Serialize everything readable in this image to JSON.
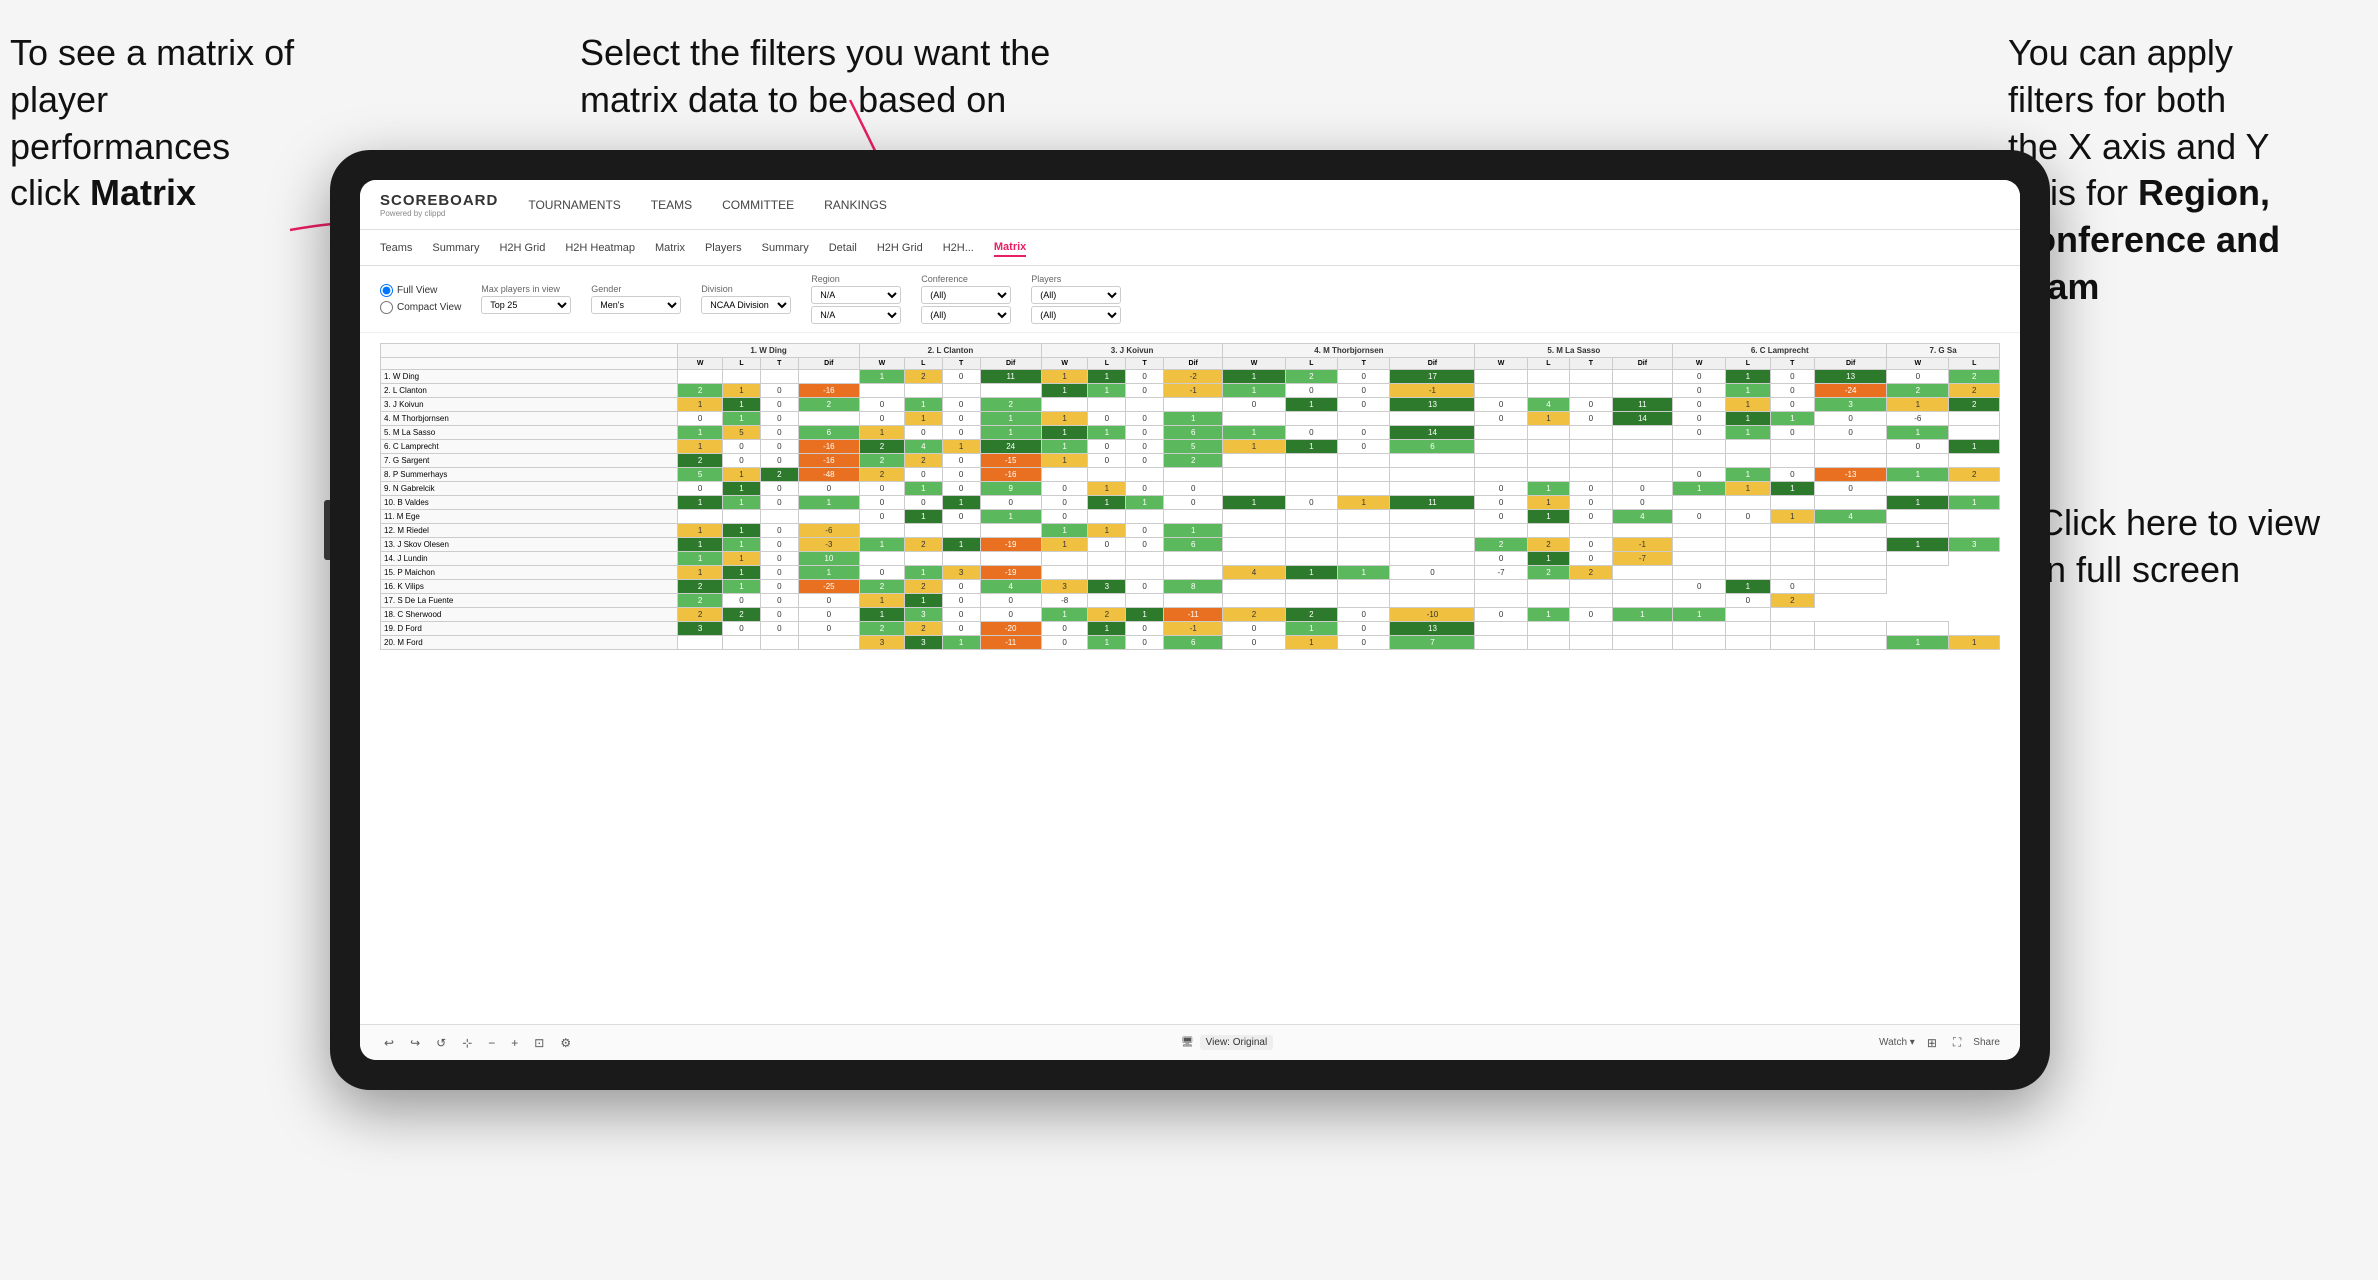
{
  "annotations": {
    "top_left": {
      "line1": "To see a matrix of",
      "line2": "player performances",
      "line3_prefix": "click ",
      "line3_bold": "Matrix"
    },
    "top_center": {
      "line1": "Select the filters you want the",
      "line2": "matrix data to be based on"
    },
    "top_right": {
      "line1": "You  can apply",
      "line2": "filters for both",
      "line3": "the X axis and Y",
      "line4_prefix": "Axis for ",
      "line4_bold": "Region,",
      "line5_bold": "Conference and",
      "line6_bold": "Team"
    },
    "bottom_right": {
      "line1": "Click here to view",
      "line2": "in full screen"
    }
  },
  "nav": {
    "logo": "SCOREBOARD",
    "logo_sub": "Powered by clippd",
    "items": [
      "TOURNAMENTS",
      "TEAMS",
      "COMMITTEE",
      "RANKINGS"
    ]
  },
  "sub_nav": {
    "tabs": [
      "Teams",
      "Summary",
      "H2H Grid",
      "H2H Heatmap",
      "Matrix",
      "Players",
      "Summary",
      "Detail",
      "H2H Grid",
      "H2H...",
      "Matrix"
    ]
  },
  "filters": {
    "view_options": [
      "Full View",
      "Compact View"
    ],
    "max_players_label": "Max players in view",
    "max_players_value": "Top 25",
    "gender_label": "Gender",
    "gender_value": "Men's",
    "division_label": "Division",
    "division_value": "NCAA Division I",
    "region_label": "Region",
    "region_value": "N/A",
    "region_value2": "N/A",
    "conference_label": "Conference",
    "conference_value": "(All)",
    "conference_value2": "(All)",
    "players_label": "Players",
    "players_value": "(All)",
    "players_value2": "(All)"
  },
  "matrix": {
    "col_headers": [
      "1. W Ding",
      "2. L Clanton",
      "3. J Koivun",
      "4. M Thorbjornsen",
      "5. M La Sasso",
      "6. C Lamprecht",
      "7. G Sa"
    ],
    "col_sub": [
      "W",
      "L",
      "T",
      "Dif"
    ],
    "rows": [
      {
        "label": "1. W Ding",
        "cells": [
          "",
          "",
          "",
          "",
          "1",
          "2",
          "0",
          "11",
          "1",
          "1",
          "0",
          "-2",
          "1",
          "2",
          "0",
          "17",
          "",
          "",
          "",
          "",
          "0",
          "1",
          "0",
          "13",
          "0",
          "2"
        ]
      },
      {
        "label": "2. L Clanton",
        "cells": [
          "2",
          "1",
          "0",
          "-16",
          "",
          "",
          "",
          "",
          "1",
          "1",
          "0",
          "-1",
          "1",
          "0",
          "0",
          "-1",
          "",
          "",
          "",
          "",
          "0",
          "1",
          "0",
          "-24",
          "2",
          "2"
        ]
      },
      {
        "label": "3. J Koivun",
        "cells": [
          "1",
          "1",
          "0",
          "2",
          "0",
          "1",
          "0",
          "2",
          "",
          "",
          "",
          "",
          "0",
          "1",
          "0",
          "13",
          "0",
          "4",
          "0",
          "11",
          "0",
          "1",
          "0",
          "3",
          "1",
          "2"
        ]
      },
      {
        "label": "4. M Thorbjornsen",
        "cells": [
          "0",
          "1",
          "0",
          "",
          "0",
          "1",
          "0",
          "1",
          "1",
          "0",
          "0",
          "1",
          "",
          "",
          "",
          "",
          "0",
          "1",
          "0",
          "14",
          "0",
          "1",
          "1",
          "0",
          "-6",
          ""
        ]
      },
      {
        "label": "5. M La Sasso",
        "cells": [
          "1",
          "5",
          "0",
          "6",
          "1",
          "0",
          "0",
          "1",
          "1",
          "1",
          "0",
          "6",
          "1",
          "0",
          "0",
          "14",
          "",
          "",
          "",
          "",
          "0",
          "1",
          "0",
          "0",
          "1",
          ""
        ]
      },
      {
        "label": "6. C Lamprecht",
        "cells": [
          "1",
          "0",
          "0",
          "-16",
          "2",
          "4",
          "1",
          "24",
          "1",
          "0",
          "0",
          "5",
          "1",
          "1",
          "0",
          "6",
          "",
          "",
          "",
          "",
          "",
          "",
          "",
          "",
          "0",
          "1"
        ]
      },
      {
        "label": "7. G Sargent",
        "cells": [
          "2",
          "0",
          "0",
          "-16",
          "2",
          "2",
          "0",
          "-15",
          "1",
          "0",
          "0",
          "2",
          "",
          "",
          "",
          "",
          "",
          "",
          "",
          "",
          "",
          "",
          "",
          "",
          ""
        ]
      },
      {
        "label": "8. P Summerhays",
        "cells": [
          "5",
          "1",
          "2",
          "-48",
          "2",
          "0",
          "0",
          "-16",
          "",
          "",
          "",
          "",
          "",
          "",
          "",
          "",
          "",
          "",
          "",
          "",
          "0",
          "1",
          "0",
          "-13",
          "1",
          "2"
        ]
      },
      {
        "label": "9. N Gabrelcik",
        "cells": [
          "0",
          "1",
          "0",
          "0",
          "0",
          "1",
          "0",
          "9",
          "0",
          "1",
          "0",
          "0",
          "",
          "",
          "",
          "",
          "0",
          "1",
          "0",
          "0",
          "1",
          "1",
          "1",
          "0",
          ""
        ]
      },
      {
        "label": "10. B Valdes",
        "cells": [
          "1",
          "1",
          "0",
          "1",
          "0",
          "0",
          "1",
          "0",
          "0",
          "1",
          "1",
          "0",
          "1",
          "0",
          "1",
          "11",
          "0",
          "1",
          "0",
          "0",
          "",
          "",
          "",
          "",
          "1",
          "1"
        ]
      },
      {
        "label": "11. M Ege",
        "cells": [
          "",
          "",
          "",
          "",
          "0",
          "1",
          "0",
          "1",
          "0",
          "",
          "",
          "",
          "",
          "",
          "",
          "",
          "0",
          "1",
          "0",
          "4",
          "0",
          "0",
          "1",
          "4",
          ""
        ]
      },
      {
        "label": "12. M Riedel",
        "cells": [
          "1",
          "1",
          "0",
          "-6",
          "",
          "",
          "",
          "",
          "1",
          "1",
          "0",
          "1",
          "",
          "",
          "",
          "",
          "",
          "",
          "",
          "",
          "",
          "",
          "",
          "",
          ""
        ]
      },
      {
        "label": "13. J Skov Olesen",
        "cells": [
          "1",
          "1",
          "0",
          "-3",
          "1",
          "2",
          "1",
          "-19",
          "1",
          "0",
          "0",
          "6",
          "",
          "",
          "",
          "",
          "2",
          "2",
          "0",
          "-1",
          "",
          "",
          "",
          "",
          "1",
          "3"
        ]
      },
      {
        "label": "14. J Lundin",
        "cells": [
          "1",
          "1",
          "0",
          "10",
          "",
          "",
          "",
          "",
          "",
          "",
          "",
          "",
          "",
          "",
          "",
          "",
          "0",
          "1",
          "0",
          "-7",
          "",
          "",
          "",
          "",
          ""
        ]
      },
      {
        "label": "15. P Maichon",
        "cells": [
          "1",
          "1",
          "0",
          "1",
          "0",
          "1",
          "3",
          "-19",
          "",
          "",
          "",
          "",
          "4",
          "1",
          "1",
          "0",
          "-7",
          "2",
          "2",
          "",
          "",
          "",
          "",
          ""
        ]
      },
      {
        "label": "16. K Vilips",
        "cells": [
          "2",
          "1",
          "0",
          "-25",
          "2",
          "2",
          "0",
          "4",
          "3",
          "3",
          "0",
          "8",
          "",
          "",
          "",
          "",
          "",
          "",
          "",
          "",
          "0",
          "1",
          "0",
          ""
        ]
      },
      {
        "label": "17. S De La Fuente",
        "cells": [
          "2",
          "0",
          "0",
          "0",
          "1",
          "1",
          "0",
          "0",
          "-8",
          "",
          "",
          "",
          "",
          "",
          "",
          "",
          "",
          "",
          "",
          "",
          "",
          "0",
          "2"
        ]
      },
      {
        "label": "18. C Sherwood",
        "cells": [
          "2",
          "2",
          "0",
          "0",
          "1",
          "3",
          "0",
          "0",
          "1",
          "2",
          "1",
          "-11",
          "2",
          "2",
          "0",
          "-10",
          "0",
          "1",
          "0",
          "1",
          "1",
          ""
        ]
      },
      {
        "label": "19. D Ford",
        "cells": [
          "3",
          "0",
          "0",
          "0",
          "2",
          "2",
          "0",
          "-20",
          "0",
          "1",
          "0",
          "-1",
          "0",
          "1",
          "0",
          "13",
          "",
          "",
          "",
          "",
          "",
          "",
          "",
          "",
          ""
        ]
      },
      {
        "label": "20. M Ford",
        "cells": [
          "",
          "",
          "",
          "",
          "3",
          "3",
          "1",
          "-11",
          "0",
          "1",
          "0",
          "6",
          "0",
          "1",
          "0",
          "7",
          "",
          "",
          "",
          "",
          "",
          "",
          "",
          "",
          "1",
          "1"
        ]
      }
    ]
  },
  "toolbar": {
    "view_label": "View: Original",
    "watch_label": "Watch ▾",
    "share_label": "Share"
  },
  "colors": {
    "accent": "#e91e63",
    "green_dark": "#2d7a2d",
    "green_mid": "#5cb85c",
    "yellow": "#f0c040",
    "orange": "#e87020"
  }
}
